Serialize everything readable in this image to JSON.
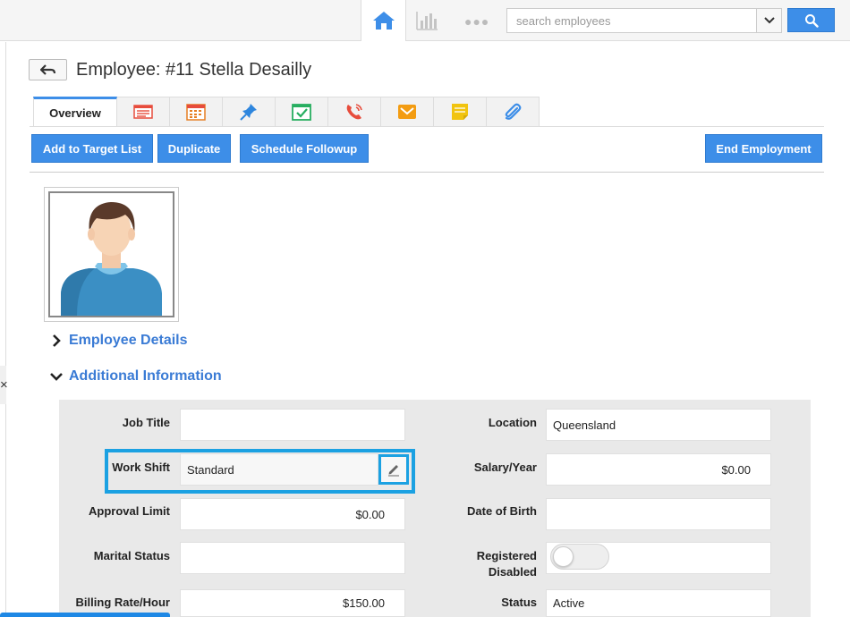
{
  "topbar": {
    "home_icon": "home-icon",
    "reports_icon": "bar-chart-icon",
    "more_icon": "more-dots-icon",
    "more_text": "●●●",
    "search": {
      "placeholder": "search employees",
      "value": ""
    },
    "search_button_icon": "search-icon",
    "dropdown_icon": "chevron-down-icon"
  },
  "header": {
    "title": "Employee: #11 Stella Desailly",
    "back_icon": "back-arrow-icon"
  },
  "tabs": [
    {
      "label": "Overview",
      "icon": "",
      "active": true
    },
    {
      "label": "",
      "icon": "list-icon",
      "color": "#e74c3c"
    },
    {
      "label": "",
      "icon": "calendar-icon",
      "color": "#e67e22"
    },
    {
      "label": "",
      "icon": "pin-icon",
      "color": "#2e86de"
    },
    {
      "label": "",
      "icon": "task-icon",
      "color": "#27ae60"
    },
    {
      "label": "",
      "icon": "phone-icon",
      "color": "#e74c3c"
    },
    {
      "label": "",
      "icon": "email-icon",
      "color": "#f39c12"
    },
    {
      "label": "",
      "icon": "note-icon",
      "color": "#f1c40f"
    },
    {
      "label": "",
      "icon": "attachment-icon",
      "color": "#3d8ee8"
    }
  ],
  "actions": {
    "add_to_target": "Add to Target List",
    "duplicate": "Duplicate",
    "schedule_followup": "Schedule Followup",
    "end_employment": "End Employment"
  },
  "sections": {
    "employee_details": "Employee Details",
    "additional_information": "Additional Information"
  },
  "form": {
    "job_title": {
      "label": "Job Title",
      "value": ""
    },
    "work_shift": {
      "label": "Work Shift",
      "value": "Standard"
    },
    "approval_limit": {
      "label": "Approval Limit",
      "value": "$0.00"
    },
    "marital_status": {
      "label": "Marital Status",
      "value": ""
    },
    "billing_rate": {
      "label": "Billing Rate/Hour",
      "value": "$150.00"
    },
    "location": {
      "label": "Location",
      "value": "Queensland"
    },
    "salary_year": {
      "label": "Salary/Year",
      "value": "$0.00"
    },
    "date_of_birth": {
      "label": "Date of Birth",
      "value": ""
    },
    "registered_disabled": {
      "label_line1": "Registered",
      "label_line2": "Disabled",
      "value": false
    },
    "status": {
      "label": "Status",
      "value": "Active"
    }
  },
  "colors": {
    "accent": "#3d8ee8",
    "highlight": "#1ba1e2",
    "section_heading": "#3a7bd5"
  }
}
